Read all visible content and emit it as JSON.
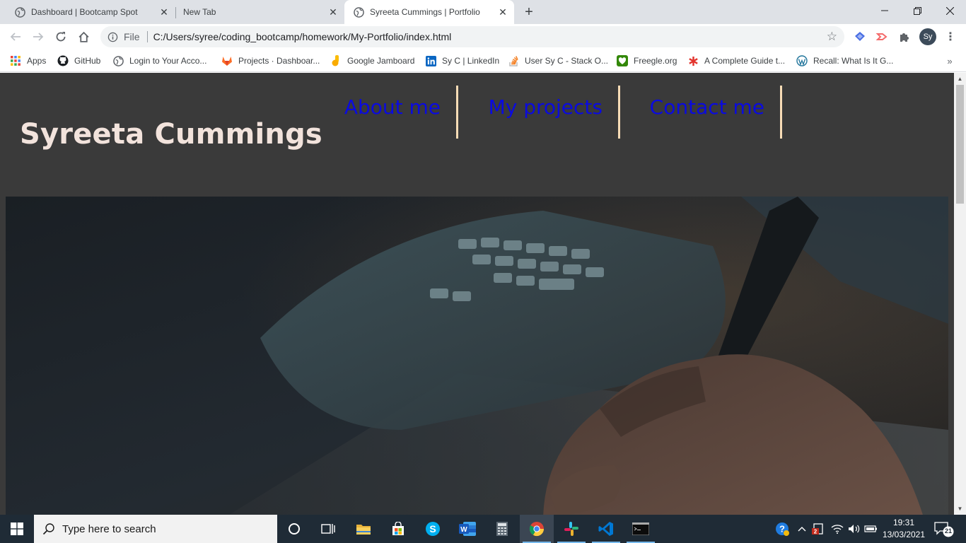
{
  "browser": {
    "tabs": [
      {
        "title": "Dashboard | Bootcamp Spot",
        "active": false
      },
      {
        "title": "New Tab",
        "active": false
      },
      {
        "title": "Syreeta Cummings | Portfolio",
        "active": true
      }
    ],
    "address": {
      "scheme_label": "File",
      "url": "C:/Users/syree/coding_bootcamp/homework/My-Portfolio/index.html"
    },
    "profile_initials": "Sy",
    "bookmarks": [
      {
        "label": "Apps",
        "icon": "apps-grid-icon"
      },
      {
        "label": "GitHub",
        "icon": "github-icon"
      },
      {
        "label": "Login to Your Acco...",
        "icon": "globe-icon"
      },
      {
        "label": "Projects · Dashboar...",
        "icon": "gitlab-icon"
      },
      {
        "label": "Google Jamboard",
        "icon": "jamboard-icon"
      },
      {
        "label": "Sy C | LinkedIn",
        "icon": "linkedin-icon"
      },
      {
        "label": "User Sy C - Stack O...",
        "icon": "stackoverflow-icon"
      },
      {
        "label": "Freegle.org",
        "icon": "freegle-icon"
      },
      {
        "label": "A Complete Guide t...",
        "icon": "asterisk-icon"
      },
      {
        "label": "Recall: What Is It G...",
        "icon": "wordpress-icon"
      }
    ]
  },
  "page": {
    "site_name": "Syreeta Cummings",
    "nav": [
      {
        "label": "About me"
      },
      {
        "label": "My projects"
      },
      {
        "label": "Contact me"
      }
    ],
    "colors": {
      "header_bg": "#3a3a3a",
      "title": "#f2e3dc",
      "nav_link": "#0a0ae0",
      "nav_divider": "#f7dcb6"
    }
  },
  "taskbar": {
    "search_placeholder": "Type here to search",
    "clock_time": "19:31",
    "clock_date": "13/03/2021",
    "notification_count": "21",
    "apps": [
      "cortana-icon",
      "task-view-icon",
      "file-explorer-icon",
      "microsoft-store-icon",
      "skype-icon",
      "word-icon",
      "calculator-icon",
      "chrome-icon",
      "slack-icon",
      "vscode-icon",
      "terminal-icon"
    ]
  }
}
